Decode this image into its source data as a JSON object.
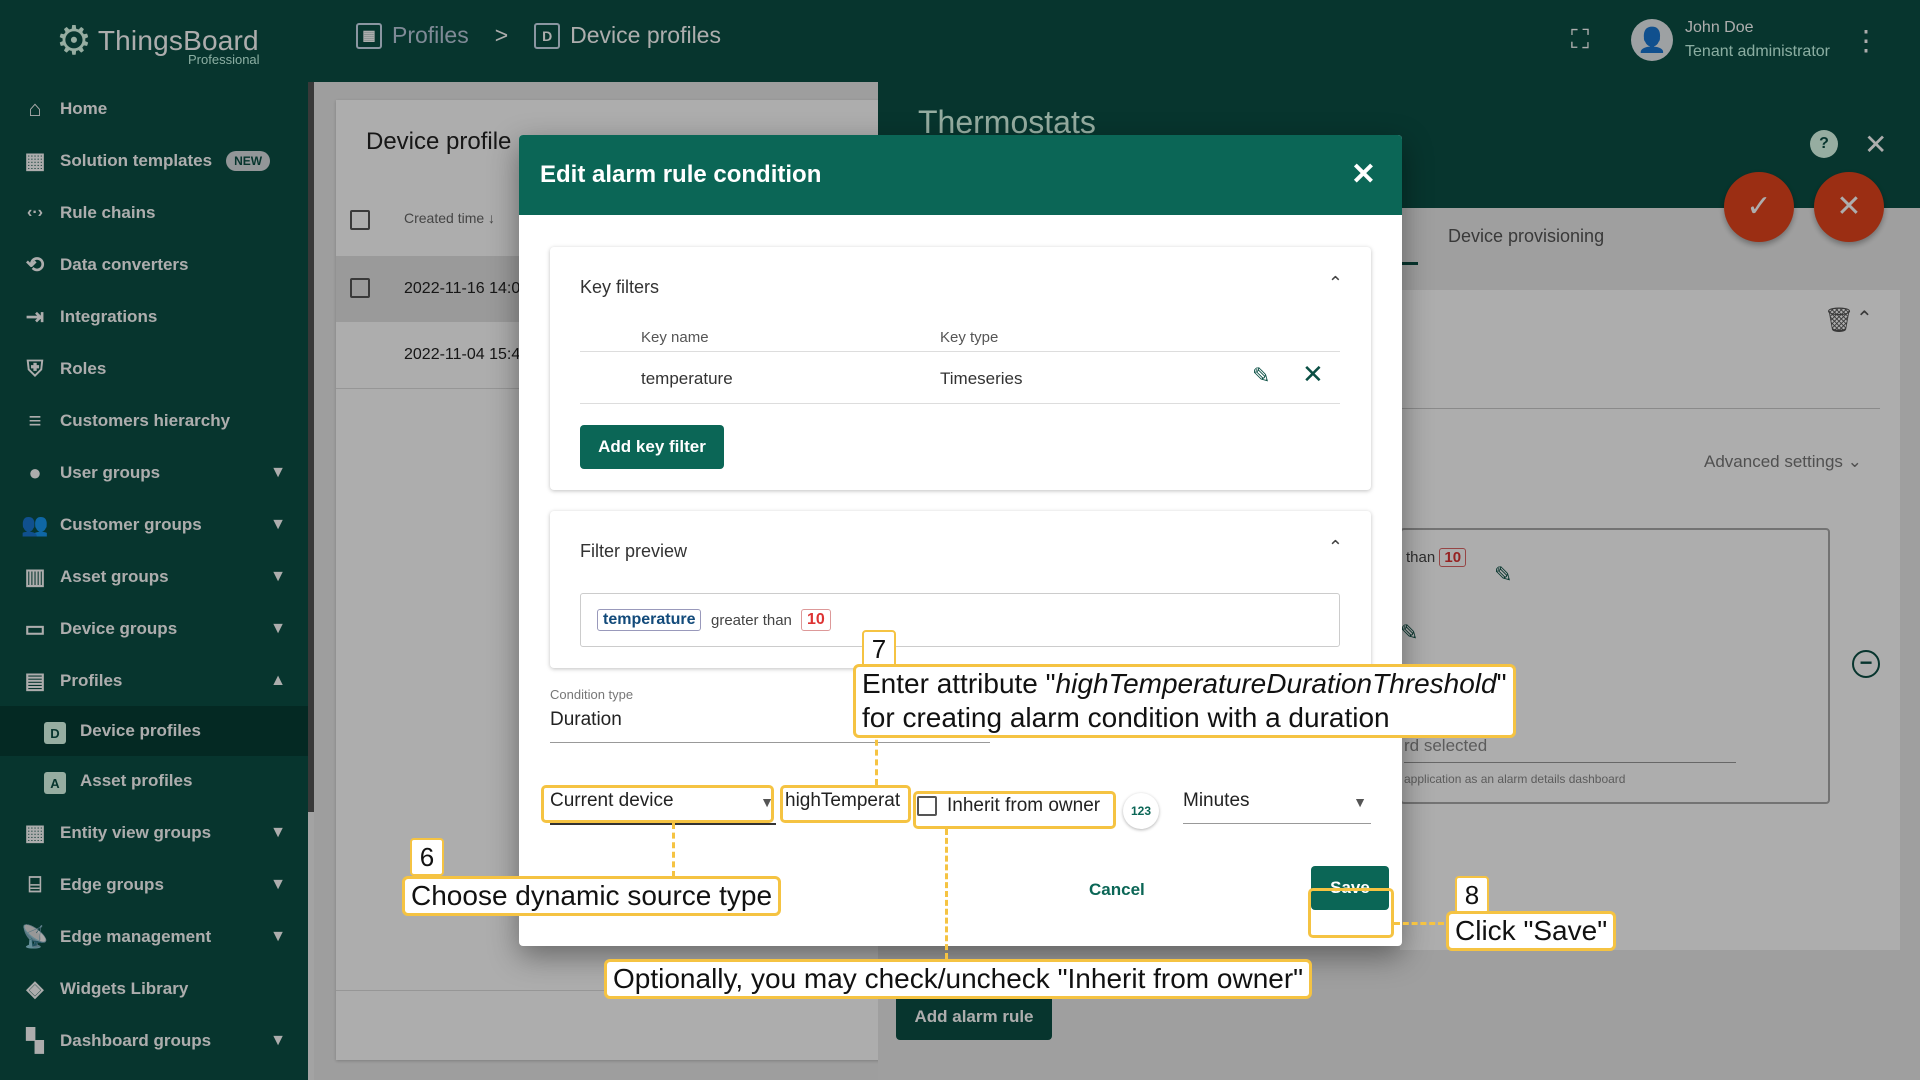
{
  "app": {
    "name": "ThingsBoard",
    "edition": "Professional"
  },
  "breadcrumb": [
    {
      "label": "Profiles",
      "icon": "badge-icon"
    },
    {
      "label": "Device profiles",
      "icon": "d-box-icon"
    }
  ],
  "breadcrumb_sep": ">",
  "user": {
    "name": "John Doe",
    "role": "Tenant administrator"
  },
  "sidebar": {
    "items": [
      {
        "label": "Home",
        "icon": "home-icon"
      },
      {
        "label": "Solution templates",
        "icon": "apps-icon",
        "badge": "NEW"
      },
      {
        "label": "Rule chains",
        "icon": "code-icon"
      },
      {
        "label": "Data converters",
        "icon": "transform-icon"
      },
      {
        "label": "Integrations",
        "icon": "input-icon"
      },
      {
        "label": "Roles",
        "icon": "shield-icon"
      },
      {
        "label": "Customers hierarchy",
        "icon": "sort-icon"
      },
      {
        "label": "User groups",
        "icon": "account-icon"
      },
      {
        "label": "Customer groups",
        "icon": "people-icon"
      },
      {
        "label": "Asset groups",
        "icon": "domain-icon"
      },
      {
        "label": "Device groups",
        "icon": "devices-icon"
      },
      {
        "label": "Profiles",
        "icon": "badge-icon"
      },
      {
        "label": "Device profiles",
        "icon": "d-box-icon"
      },
      {
        "label": "Asset profiles",
        "icon": "a-box-icon"
      },
      {
        "label": "Entity view groups",
        "icon": "view-quilt-icon"
      },
      {
        "label": "Edge groups",
        "icon": "router-icon"
      },
      {
        "label": "Edge management",
        "icon": "settings-input-antenna-icon"
      },
      {
        "label": "Widgets Library",
        "icon": "widgets-icon"
      },
      {
        "label": "Dashboard groups",
        "icon": "dashboard-icon"
      }
    ]
  },
  "list": {
    "title": "Device profile",
    "column_created": "Created time",
    "rows": [
      {
        "created": "2022-11-16 14:0"
      },
      {
        "created": "2022-11-04 15:4"
      }
    ],
    "add_alarm_rule": "Add alarm rule"
  },
  "detail": {
    "title": "Thermostats",
    "tab_provisioning": "Device provisioning",
    "advanced_settings": "Advanced settings",
    "than_text": "than",
    "than_value": "10",
    "not_selected": "rd selected",
    "app_note": "application as an alarm details dashboard"
  },
  "dialog": {
    "title": "Edit alarm rule condition",
    "key_filters": {
      "title": "Key filters",
      "col_key_name": "Key name",
      "col_key_type": "Key type",
      "rows": [
        {
          "key_name": "temperature",
          "key_type": "Timeseries"
        }
      ],
      "add_button": "Add key filter"
    },
    "filter_preview": {
      "title": "Filter preview",
      "key": "temperature",
      "operator": "greater than",
      "value": "10"
    },
    "condition": {
      "label": "Condition type",
      "value": "Duration",
      "source_type": "Current device",
      "attribute": "highTemperat",
      "inherit_label": "Inherit from owner",
      "inherit_checked": false,
      "numeric_icon": "123",
      "unit": "Minutes"
    },
    "cancel": "Cancel",
    "save": "Save"
  },
  "annotations": {
    "step6": {
      "num": "6",
      "text": "Choose dynamic source type"
    },
    "step7": {
      "num": "7",
      "line1_prefix": "Enter attribute \"",
      "line1_attr": "highTemperatureDurationThreshold",
      "line1_suffix": "\"",
      "line2": "for creating alarm condition with a duration"
    },
    "step8": {
      "num": "8",
      "text": "Click \"Save\""
    },
    "inherit_note": "Optionally, you may check/uncheck \"Inherit from owner\""
  },
  "colors": {
    "primary": "#0b4f44",
    "dialog_header": "#0b6656",
    "accent": "#e5451d",
    "annotation": "#f5c342"
  }
}
